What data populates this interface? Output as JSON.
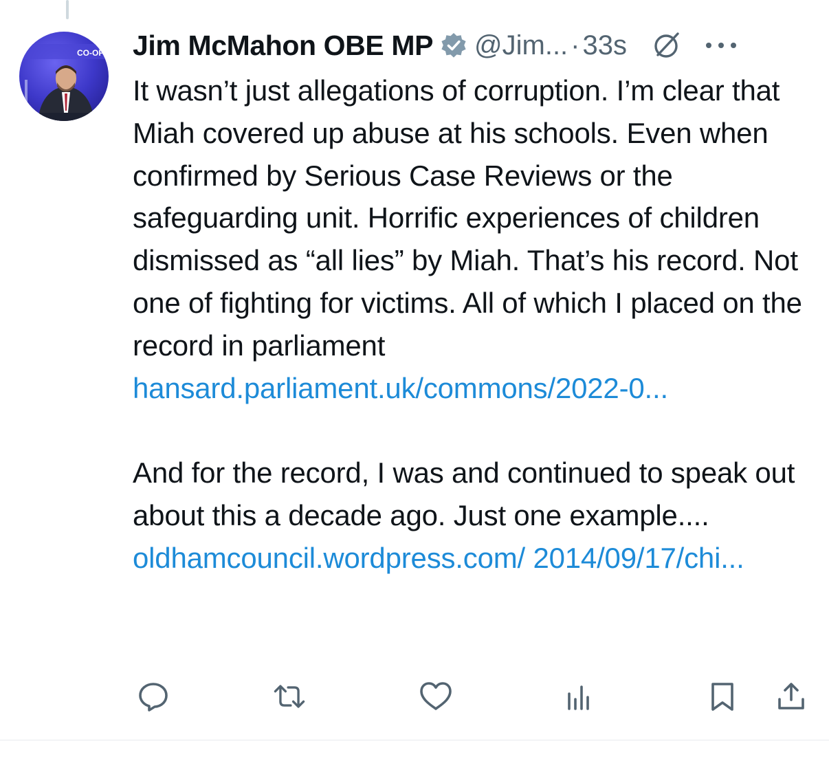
{
  "tweet": {
    "author_name": "Jim McMahon OBE MP",
    "handle": "@Jim...",
    "separator": "·",
    "timestamp": "33s",
    "paragraph1": {
      "text": "It wasn’t just allegations of corruption. I’m clear that Miah covered up abuse at his schools. Even when confirmed by Serious Case Reviews or the safeguarding unit. Horrific experiences of children dismissed as “all lies” by Miah. That’s his record. Not one of fighting for victims. All of which I placed on the record in parliament",
      "link": "hansard.parliament.uk/commons/2022-0..."
    },
    "paragraph2": {
      "text": "And for the record, I was and continued to speak out about this a decade ago. Just one example.... ",
      "link": "oldhamcouncil.wordpress.com/ 2014/09/17/chi..."
    },
    "avatar_banner_text": "CO-OP"
  },
  "icons": {
    "verified": "verified-badge-icon",
    "grok": "grok-icon",
    "more": "more-icon",
    "reply": "reply-icon",
    "repost": "repost-icon",
    "like": "like-icon",
    "views": "views-icon",
    "bookmark": "bookmark-icon",
    "share": "share-icon"
  },
  "colors": {
    "text": "#0f1419",
    "secondary": "#536471",
    "link": "#1d8bd8",
    "verified": "#829aab",
    "avatar_bg": "#3d38c9"
  }
}
